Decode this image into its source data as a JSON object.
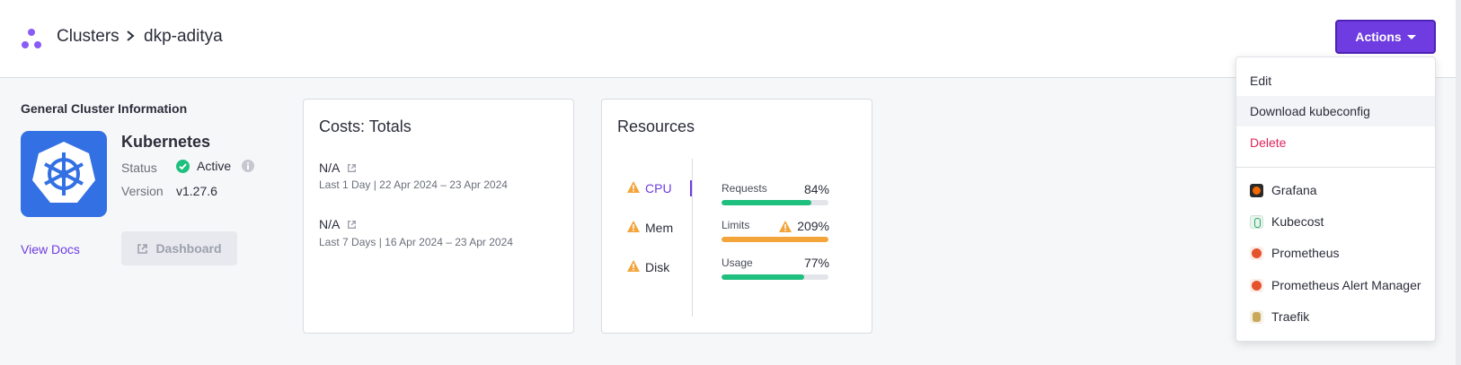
{
  "breadcrumb": {
    "root": "Clusters",
    "current": "dkp-aditya"
  },
  "actions": {
    "label": "Actions",
    "menu": [
      {
        "label": "Edit"
      },
      {
        "label": "Download kubeconfig"
      },
      {
        "label": "Delete"
      }
    ],
    "links": [
      {
        "label": "Grafana",
        "icon": "grafana-icon"
      },
      {
        "label": "Kubecost",
        "icon": "kubecost-icon"
      },
      {
        "label": "Prometheus",
        "icon": "prometheus-icon"
      },
      {
        "label": "Prometheus Alert Manager",
        "icon": "alertmanager-icon"
      },
      {
        "label": "Traefik",
        "icon": "traefik-icon"
      }
    ]
  },
  "general": {
    "title": "General Cluster Information",
    "name": "Kubernetes",
    "status_label": "Status",
    "status_value": "Active",
    "version_label": "Version",
    "version_value": "v1.27.6",
    "view_docs": "View Docs",
    "dashboard": "Dashboard"
  },
  "costs": {
    "title": "Costs: Totals",
    "rows": [
      {
        "value": "N/A",
        "period": "Last 1 Day | 22 Apr 2024 – 23 Apr 2024"
      },
      {
        "value": "N/A",
        "period": "Last 7 Days | 16 Apr 2024 – 23 Apr 2024"
      }
    ]
  },
  "resources": {
    "title": "Resources",
    "tabs": [
      {
        "label": "CPU",
        "active": true
      },
      {
        "label": "Mem",
        "active": false
      },
      {
        "label": "Disk",
        "active": false
      }
    ],
    "metrics": [
      {
        "label": "Requests",
        "value": "84%",
        "fill": 0.84,
        "color": "#1fbf7f",
        "warn": false
      },
      {
        "label": "Limits",
        "value": "209%",
        "fill": 1.0,
        "color": "#f3a43a",
        "warn": true
      },
      {
        "label": "Usage",
        "value": "77%",
        "fill": 0.77,
        "color": "#1fbf7f",
        "warn": false
      }
    ]
  },
  "colors": {
    "accent": "#6e3ce0",
    "success": "#1fbf7f",
    "warning": "#f3a43a",
    "danger": "#e0245e",
    "k8s": "#3370e3"
  }
}
